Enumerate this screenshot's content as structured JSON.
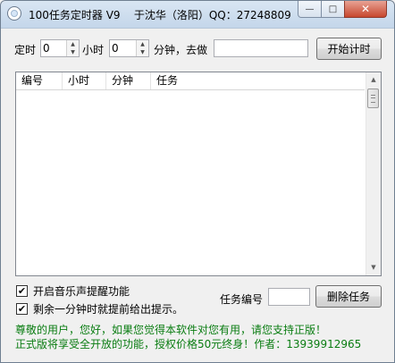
{
  "window": {
    "title": "100任务定时器 V9    于沈华（洛阳）QQ：27248809",
    "minimize_glyph": "—",
    "maximize_glyph": "□",
    "close_glyph": "✕"
  },
  "timer_row": {
    "label_timing": "定时",
    "hours_value": "0",
    "label_hours": "小时",
    "minutes_value": "0",
    "label_minutes_then": "分钟，去做",
    "task_value": "",
    "start_button": "开始计时"
  },
  "task_list": {
    "columns": [
      "编号",
      "小时",
      "分钟",
      "任务"
    ],
    "rows": []
  },
  "options": {
    "music_reminder": {
      "label": "开启音乐声提醒功能",
      "checked": true
    },
    "one_minute_warning": {
      "label": "剩余一分钟时就提前给出提示。",
      "checked": true
    }
  },
  "delete_area": {
    "label": "任务编号",
    "value": "",
    "button": "删除任务"
  },
  "footer": {
    "line1": "尊敬的用户，您好，如果您觉得本软件对您有用，请您支持正版！",
    "line2": "正式版将享受全开放的功能，授权价格50元终身！作者：13939912965",
    "color": "#0a7d12"
  },
  "icons": {
    "app": "app-icon",
    "spin_up": "▲",
    "spin_down": "▼",
    "scroll_up": "▲",
    "scroll_down": "▼",
    "check_mark": "✔"
  }
}
